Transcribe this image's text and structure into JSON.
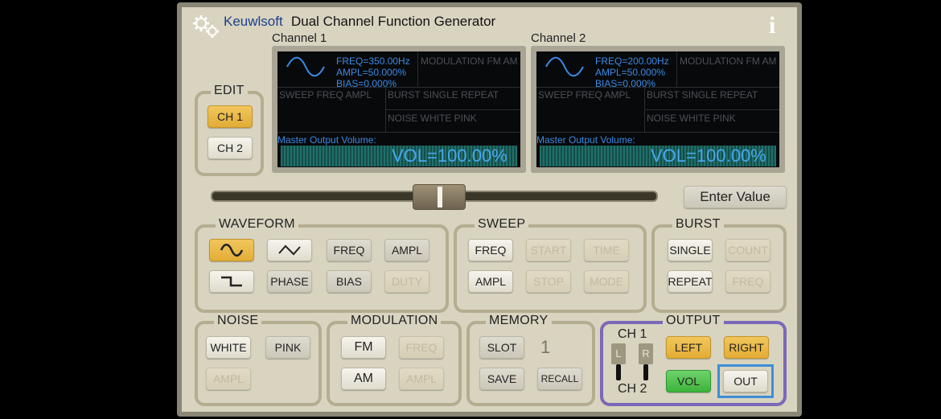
{
  "header": {
    "brand": "Keuwlsoft",
    "title": "Dual Channel Function Generator",
    "info_icon": "i"
  },
  "channels": [
    {
      "label": "Channel 1",
      "freq": "FREQ=350.00Hz",
      "ampl": "AMPL=50.000%",
      "bias": "BIAS=0.000%",
      "modulation": "MODULATION  FM  AM",
      "sweep": "SWEEP   FREQ  AMPL",
      "burst": "BURST   SINGLE  REPEAT",
      "noise": "NOISE    WHITE   PINK",
      "master_label": "Master Output Volume:",
      "vol": "VOL=100.00%"
    },
    {
      "label": "Channel 2",
      "freq": "FREQ=200.00Hz",
      "ampl": "AMPL=50.000%",
      "bias": "BIAS=0.000%",
      "modulation": "MODULATION  FM  AM",
      "sweep": "SWEEP   FREQ  AMPL",
      "burst": "BURST   SINGLE  REPEAT",
      "noise": "NOISE    WHITE   PINK",
      "master_label": "Master Output Volume:",
      "vol": "VOL=100.00%"
    }
  ],
  "edit": {
    "label": "EDIT",
    "ch1": "CH 1",
    "ch2": "CH 2",
    "selected": "CH 1"
  },
  "slider": {
    "value_fraction": 0.51
  },
  "enter_value": "Enter Value",
  "waveform": {
    "label": "WAVEFORM",
    "sine_icon": "∿",
    "triangle_icon": "triangle-wave",
    "square_icon": "square-wave",
    "freq": "FREQ",
    "ampl": "AMPL",
    "phase": "PHASE",
    "bias": "BIAS",
    "duty": "DUTY"
  },
  "sweep": {
    "label": "SWEEP",
    "freq": "FREQ",
    "start": "START",
    "time": "TIME",
    "ampl": "AMPL",
    "stop": "STOP",
    "mode": "MODE"
  },
  "burst": {
    "label": "BURST",
    "single": "SINGLE",
    "count": "COUNT",
    "repeat": "REPEAT",
    "freq": "FREQ"
  },
  "noise": {
    "label": "NOISE",
    "white": "WHITE",
    "pink": "PINK",
    "ampl": "AMPL"
  },
  "modulation": {
    "label": "MODULATION",
    "fm": "FM",
    "freq": "FREQ",
    "am": "AM",
    "ampl": "AMPL"
  },
  "memory": {
    "label": "MEMORY",
    "slot": "SLOT",
    "slot_number": "1",
    "save": "SAVE",
    "recall": "RECALL"
  },
  "output": {
    "label": "OUTPUT",
    "ch1": "CH 1",
    "ch2": "CH 2",
    "l": "L",
    "r": "R",
    "left": "LEFT",
    "right": "RIGHT",
    "vol": "VOL",
    "out": "OUT"
  },
  "colors": {
    "accent_yellow": "#e8b545",
    "accent_green": "#4cc04a",
    "screen_text": "#3a8be6",
    "output_border": "#7c68b8"
  }
}
